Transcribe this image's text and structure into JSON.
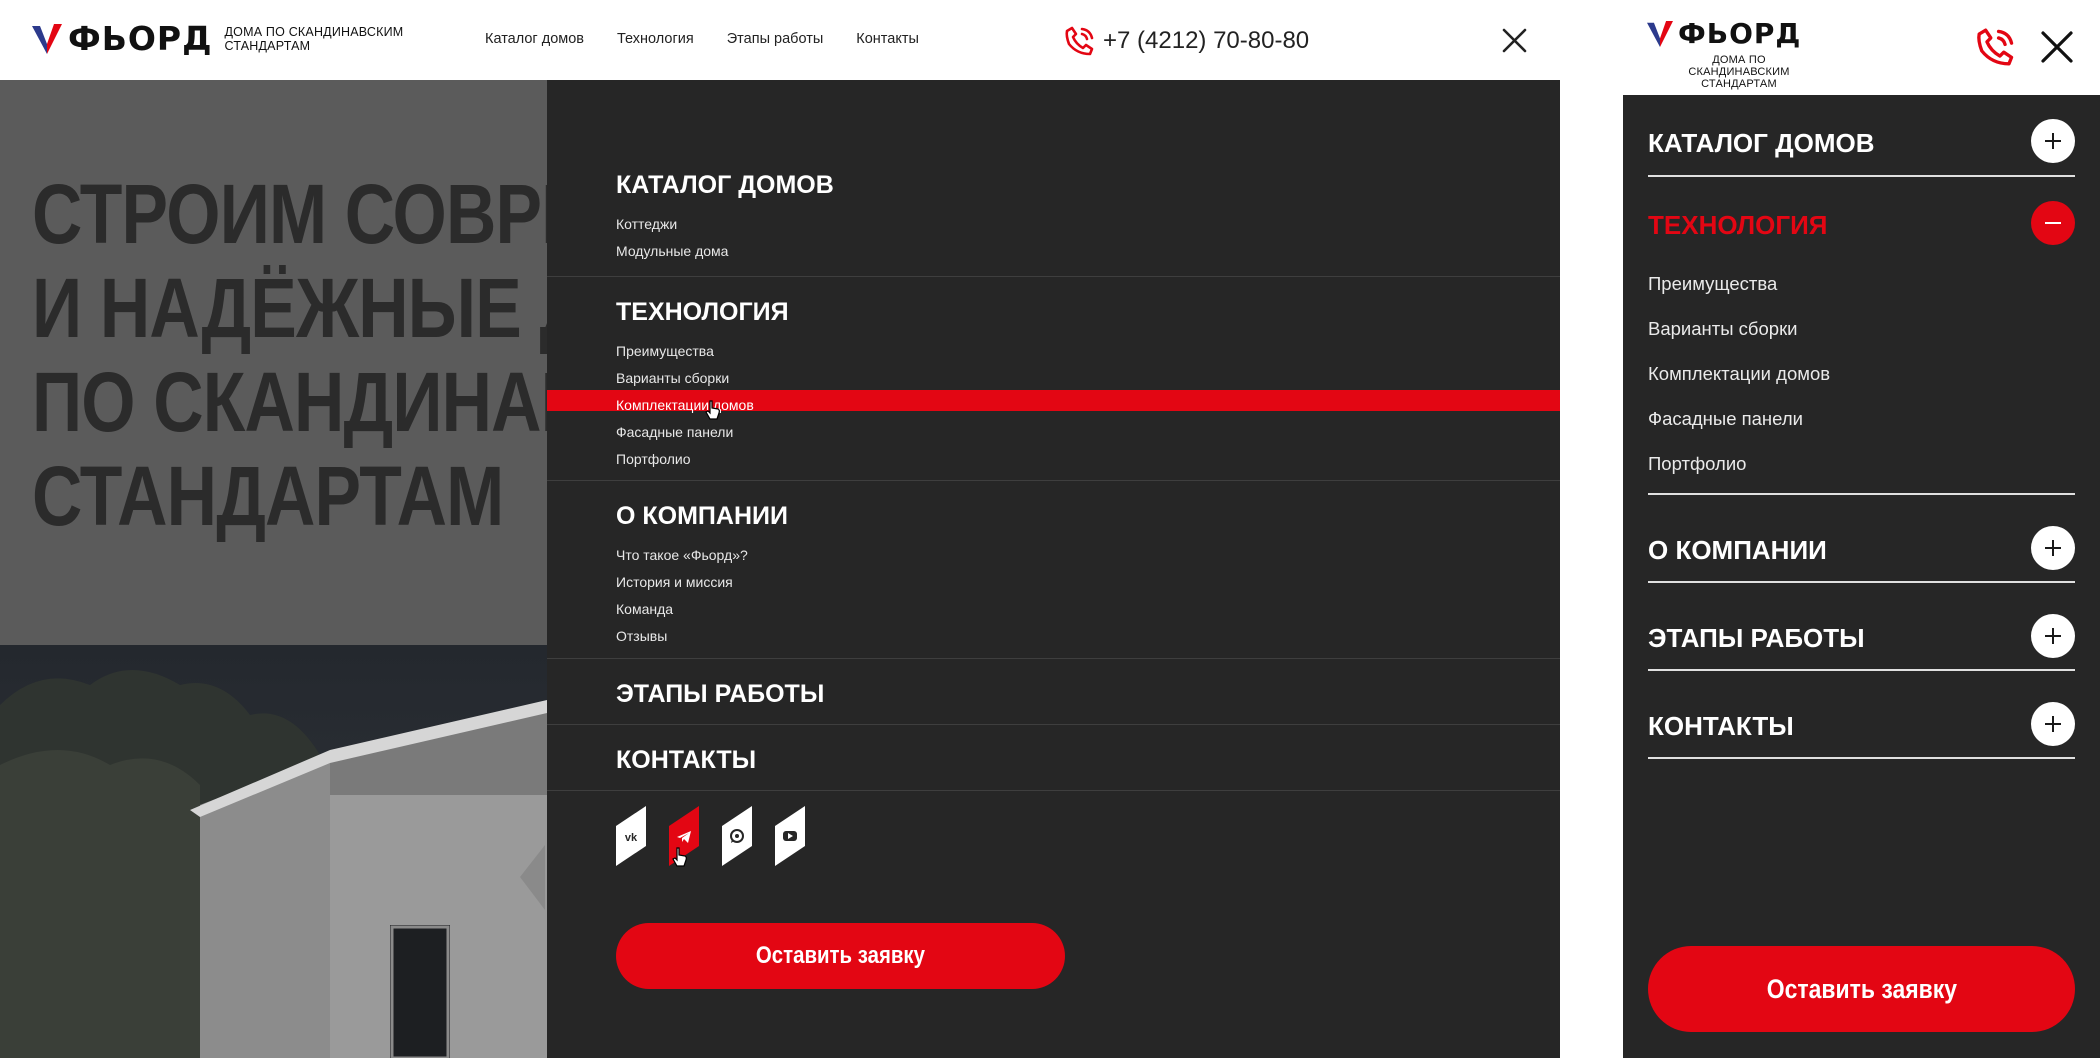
{
  "brand": {
    "name": "ФЬОРД",
    "tagline": "ДОМА ПО СКАНДИНАВСКИМ СТАНДАРТАМ",
    "colors": {
      "blue": "#2c3a8c",
      "red": "#e30613",
      "dark": "#262626"
    }
  },
  "desktop": {
    "nav": [
      "Каталог домов",
      "Технология",
      "Этапы работы",
      "Контакты"
    ],
    "phone": "+7 (4212) 70-80-80",
    "icons": {
      "phone": "phone-icon",
      "close": "close-icon"
    },
    "hero_lines": [
      "СТРОИМ СОВРЕМЕННЫЕ",
      "И НАДЁЖНЫЕ ДОМА",
      "ПО СКАНДИНАВСКИМ",
      "СТАНДАРТАМ"
    ],
    "menu": [
      {
        "title": "КАТАЛОГ ДОМОВ",
        "links": [
          "Коттеджи",
          "Модульные дома"
        ]
      },
      {
        "title": "ТЕХНОЛОГИЯ",
        "links": [
          "Преимущества",
          "Варианты сборки",
          "Комплектации домов",
          "Фасадные панели",
          "Портфолио"
        ],
        "hovered_link": "Комплектации домов"
      },
      {
        "title": "О КОМПАНИИ",
        "links": [
          "Что такое «Фьорд»?",
          "История и миссия",
          "Команда",
          "Отзывы"
        ]
      },
      {
        "title": "ЭТАПЫ РАБОТЫ",
        "links": []
      },
      {
        "title": "КОНТАКТЫ",
        "links": []
      }
    ],
    "socials": [
      "vk-icon",
      "telegram-icon",
      "whatsapp-icon",
      "youtube-icon"
    ],
    "hovered_social": "telegram-icon",
    "cta": "Оставить заявку"
  },
  "mobile": {
    "menu": [
      {
        "title": "КАТАЛОГ ДОМОВ",
        "expanded": false
      },
      {
        "title": "ТЕХНОЛОГИЯ",
        "expanded": true,
        "links": [
          "Преимущества",
          "Варианты сборки",
          "Комплектации домов",
          "Фасадные панели",
          "Портфолио"
        ]
      },
      {
        "title": "О КОМПАНИИ",
        "expanded": false
      },
      {
        "title": "ЭТАПЫ РАБОТЫ",
        "expanded": false
      },
      {
        "title": "КОНТАКТЫ",
        "expanded": false
      }
    ],
    "icons": {
      "phone": "phone-icon",
      "close": "close-icon",
      "expand": "plus-icon",
      "collapse": "minus-icon"
    },
    "cta": "Оставить заявку"
  }
}
